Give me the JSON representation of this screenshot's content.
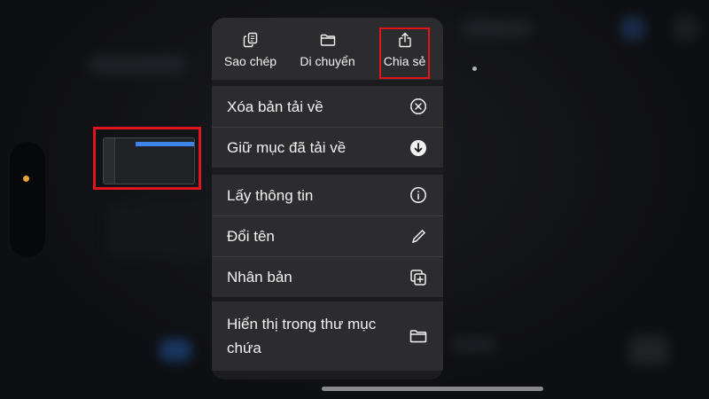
{
  "top_actions": [
    {
      "label": "Sao chép",
      "icon": "copy-icon"
    },
    {
      "label": "Di chuyển",
      "icon": "folder-icon"
    },
    {
      "label": "Chia sẻ",
      "icon": "share-icon"
    }
  ],
  "menu_groups": [
    {
      "items": [
        {
          "label": "Xóa bản tải về",
          "icon": "remove-download-icon"
        },
        {
          "label": "Giữ mục đã tải về",
          "icon": "download-icon"
        }
      ]
    },
    {
      "items": [
        {
          "label": "Lấy thông tin",
          "icon": "info-icon"
        },
        {
          "label": "Đổi tên",
          "icon": "pencil-icon"
        },
        {
          "label": "Nhân bản",
          "icon": "duplicate-icon"
        }
      ]
    },
    {
      "items": [
        {
          "label": "Hiển thị trong thư mục chứa",
          "icon": "folder-icon"
        }
      ]
    }
  ],
  "colors": {
    "menu_bg": "#2c2c2e",
    "highlight": "#e0161c",
    "accent_dot": "#e8a33a",
    "thumbnail_bar": "#3b84e8"
  }
}
